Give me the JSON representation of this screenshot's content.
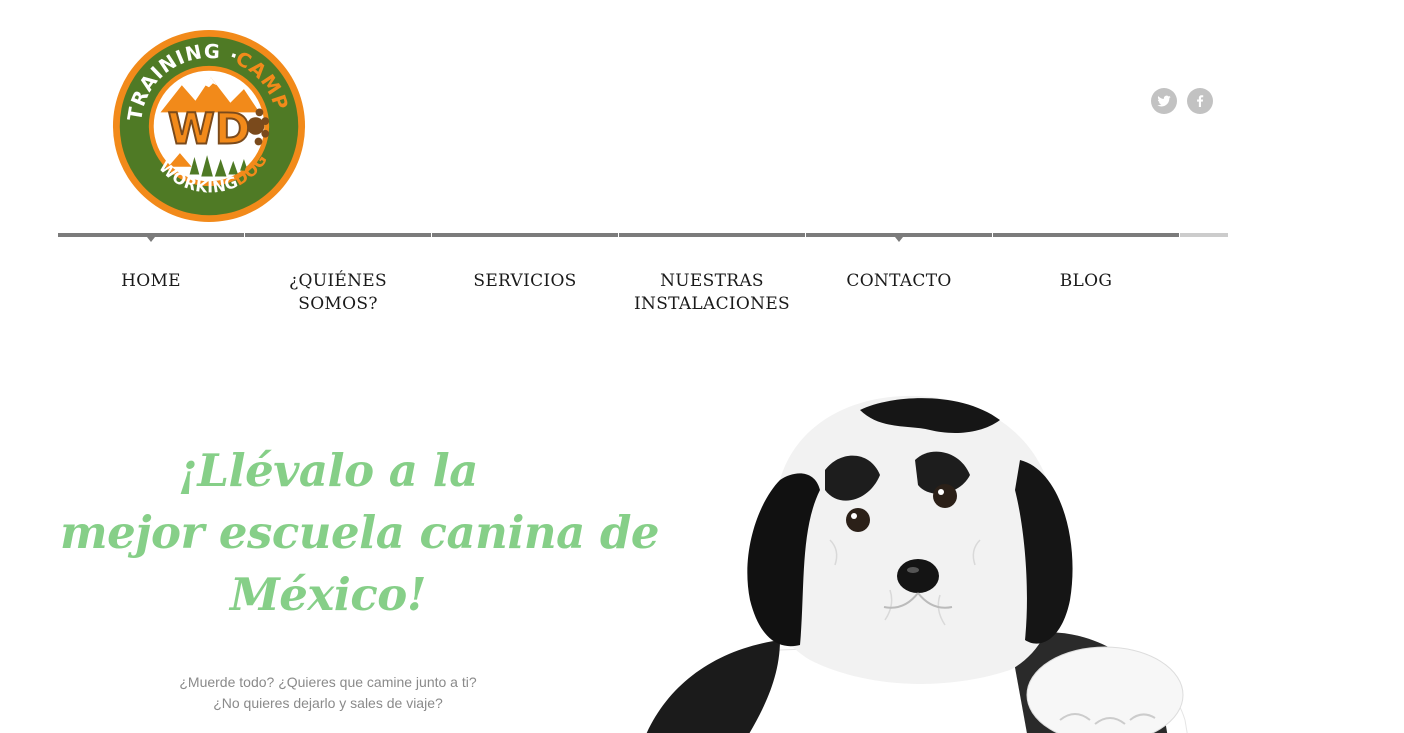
{
  "brand": {
    "logo_icon": "working-dog-training-camp-logo",
    "logo_text": {
      "top": "CAMP",
      "left": "TRAINING",
      "bottom_left": "WORKING",
      "bottom_right": "DOG",
      "monogram": "WD"
    },
    "colors": {
      "orange": "#f28a1a",
      "green": "#4f7a25",
      "accent_green": "#86cf88"
    }
  },
  "social": [
    {
      "name": "twitter",
      "icon": "twitter-icon"
    },
    {
      "name": "facebook",
      "icon": "facebook-icon"
    }
  ],
  "nav": {
    "items": [
      {
        "label": "HOME",
        "active": true
      },
      {
        "label": "¿QUIÉNES SOMOS?",
        "active": false
      },
      {
        "label": "SERVICIOS",
        "active": false
      },
      {
        "label": "NUESTRAS INSTALACIONES",
        "active": false
      },
      {
        "label": "CONTACTO",
        "active": true
      },
      {
        "label": "BLOG",
        "active": false
      }
    ]
  },
  "hero": {
    "title_lines": [
      "¡Llévalo a la",
      "mejor escuela canina de",
      "México!"
    ],
    "subtitle_lines": [
      "¿Muerde todo? ¿Quieres que camine junto a ti?",
      "¿No quieres dejarlo y sales de viaje?"
    ],
    "image": "puppy-photo"
  }
}
